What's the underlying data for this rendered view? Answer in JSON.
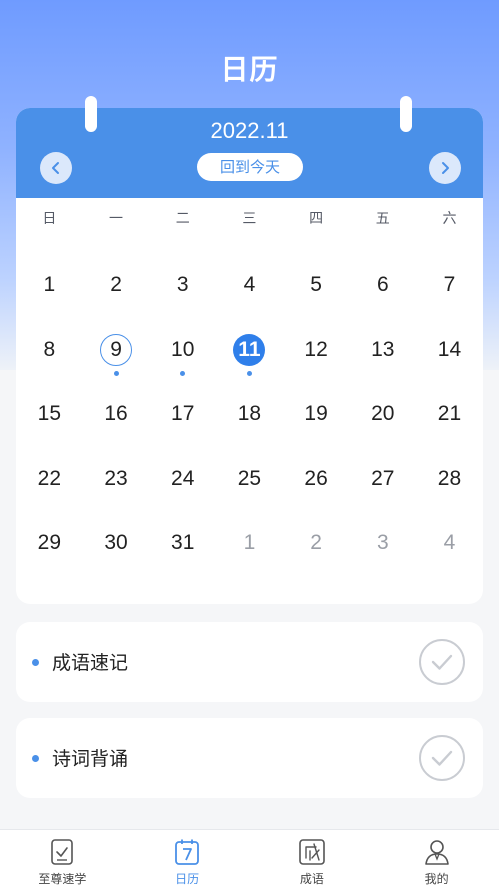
{
  "page": {
    "title": "日历"
  },
  "calendar": {
    "month_label": "2022.11",
    "today_button": "回到今天",
    "weekdays": [
      "日",
      "一",
      "二",
      "三",
      "四",
      "五",
      "六"
    ],
    "days": [
      {
        "label": "1",
        "state": "normal",
        "dot": false
      },
      {
        "label": "2",
        "state": "normal",
        "dot": false
      },
      {
        "label": "3",
        "state": "normal",
        "dot": false
      },
      {
        "label": "4",
        "state": "normal",
        "dot": false
      },
      {
        "label": "5",
        "state": "normal",
        "dot": false
      },
      {
        "label": "6",
        "state": "normal",
        "dot": false
      },
      {
        "label": "7",
        "state": "normal",
        "dot": false
      },
      {
        "label": "8",
        "state": "normal",
        "dot": false
      },
      {
        "label": "9",
        "state": "marked",
        "dot": true
      },
      {
        "label": "10",
        "state": "normal",
        "dot": true
      },
      {
        "label": "11",
        "state": "today",
        "dot": true
      },
      {
        "label": "12",
        "state": "normal",
        "dot": false
      },
      {
        "label": "13",
        "state": "normal",
        "dot": false
      },
      {
        "label": "14",
        "state": "normal",
        "dot": false
      },
      {
        "label": "15",
        "state": "normal",
        "dot": false
      },
      {
        "label": "16",
        "state": "normal",
        "dot": false
      },
      {
        "label": "17",
        "state": "normal",
        "dot": false
      },
      {
        "label": "18",
        "state": "normal",
        "dot": false
      },
      {
        "label": "19",
        "state": "normal",
        "dot": false
      },
      {
        "label": "20",
        "state": "normal",
        "dot": false
      },
      {
        "label": "21",
        "state": "normal",
        "dot": false
      },
      {
        "label": "22",
        "state": "normal",
        "dot": false
      },
      {
        "label": "23",
        "state": "normal",
        "dot": false
      },
      {
        "label": "24",
        "state": "normal",
        "dot": false
      },
      {
        "label": "25",
        "state": "normal",
        "dot": false
      },
      {
        "label": "26",
        "state": "normal",
        "dot": false
      },
      {
        "label": "27",
        "state": "normal",
        "dot": false
      },
      {
        "label": "28",
        "state": "normal",
        "dot": false
      },
      {
        "label": "29",
        "state": "normal",
        "dot": false
      },
      {
        "label": "30",
        "state": "normal",
        "dot": false
      },
      {
        "label": "31",
        "state": "normal",
        "dot": false
      },
      {
        "label": "1",
        "state": "other",
        "dot": false
      },
      {
        "label": "2",
        "state": "other",
        "dot": false
      },
      {
        "label": "3",
        "state": "other",
        "dot": false
      },
      {
        "label": "4",
        "state": "other",
        "dot": false
      }
    ]
  },
  "tasks": [
    {
      "label": "成语速记",
      "icon": "check-circle-icon"
    },
    {
      "label": "诗词背诵",
      "icon": "check-circle-icon"
    }
  ],
  "tabbar": {
    "items": [
      {
        "label": "至尊速学",
        "icon": "checklist-icon",
        "active": false
      },
      {
        "label": "日历",
        "icon": "calendar-icon",
        "active": true
      },
      {
        "label": "成语",
        "icon": "idiom-icon",
        "active": false
      },
      {
        "label": "我的",
        "icon": "user-icon",
        "active": false
      }
    ]
  },
  "colors": {
    "accent": "#4a90e8",
    "today": "#2f7fea",
    "muted_day": "#9a9ea6"
  }
}
